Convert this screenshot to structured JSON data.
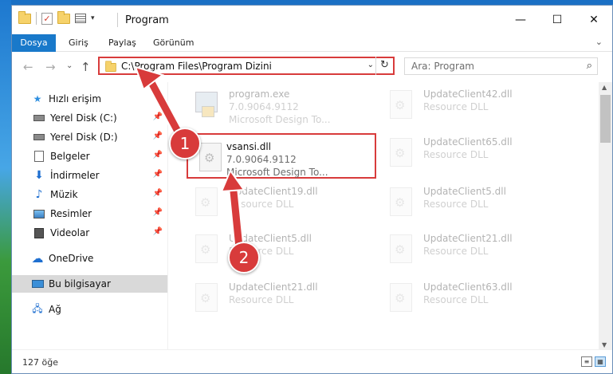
{
  "titlebar": {
    "title": "Program",
    "minimize": "—",
    "maximize": "☐",
    "close": "✕"
  },
  "ribbon": {
    "tabs": [
      "Dosya",
      "Giriş",
      "Paylaş",
      "Görünüm"
    ],
    "expand": "⌄",
    "help": "?"
  },
  "nav": {
    "back": "←",
    "forward": "→",
    "recent": "⌄",
    "up": "↑"
  },
  "address": {
    "path": "C:\\Program Files\\Program Dizini",
    "chevron": "⌄",
    "refresh": "↻"
  },
  "search": {
    "placeholder": "Ara: Program",
    "icon": "search-icon"
  },
  "sidebar": {
    "items": [
      {
        "label": "Hızlı erişim",
        "icon": "star-icon"
      },
      {
        "label": "Yerel Disk (C:)",
        "icon": "drive-icon",
        "pinned": true
      },
      {
        "label": "Yerel Disk (D:)",
        "icon": "drive-icon",
        "pinned": true
      },
      {
        "label": "Belgeler",
        "icon": "documents-icon",
        "pinned": true
      },
      {
        "label": "İndirmeler",
        "icon": "downloads-icon",
        "pinned": true
      },
      {
        "label": "Müzik",
        "icon": "music-icon",
        "pinned": true
      },
      {
        "label": "Resimler",
        "icon": "pictures-icon",
        "pinned": true
      },
      {
        "label": "Videolar",
        "icon": "videos-icon",
        "pinned": true
      },
      {
        "label": "OneDrive",
        "icon": "cloud-icon"
      },
      {
        "label": "Bu bilgisayar",
        "icon": "computer-icon",
        "selected": true
      },
      {
        "label": "Ağ",
        "icon": "network-icon"
      }
    ]
  },
  "files": [
    {
      "name": "program.exe",
      "line2": "7.0.9064.9112",
      "line3": "Microsoft Design To...",
      "col": 0,
      "row": 0
    },
    {
      "name": "UpdateClient42.dll",
      "line2": "Resource DLL",
      "col": 1,
      "row": 0
    },
    {
      "name": "UpdateClient65.dll",
      "line2": "Resource DLL",
      "col": 1,
      "row": 1
    },
    {
      "name": "UpdateClient19.dll",
      "line2": "Resource DLL",
      "col": 0,
      "row": 2
    },
    {
      "name": "UpdateClient5.dll",
      "line2": "Resource DLL",
      "col": 1,
      "row": 2
    },
    {
      "name": "UpdateClient5.dll",
      "line2": "Resource DLL",
      "col": 0,
      "row": 3
    },
    {
      "name": "UpdateClient21.dll",
      "line2": "Resource DLL",
      "col": 1,
      "row": 3
    },
    {
      "name": "UpdateClient21.dll",
      "line2": "Resource DLL",
      "col": 0,
      "row": 4
    },
    {
      "name": "UpdateClient63.dll",
      "line2": "Resource DLL",
      "col": 1,
      "row": 4
    }
  ],
  "highlighted": {
    "name": "vsansi.dll",
    "line2": "7.0.9064.9112",
    "line3": "Microsoft Design To..."
  },
  "status": {
    "count": "127 öğe"
  },
  "annotations": {
    "step1": "1",
    "step2": "2",
    "color": "#d83b3b"
  }
}
